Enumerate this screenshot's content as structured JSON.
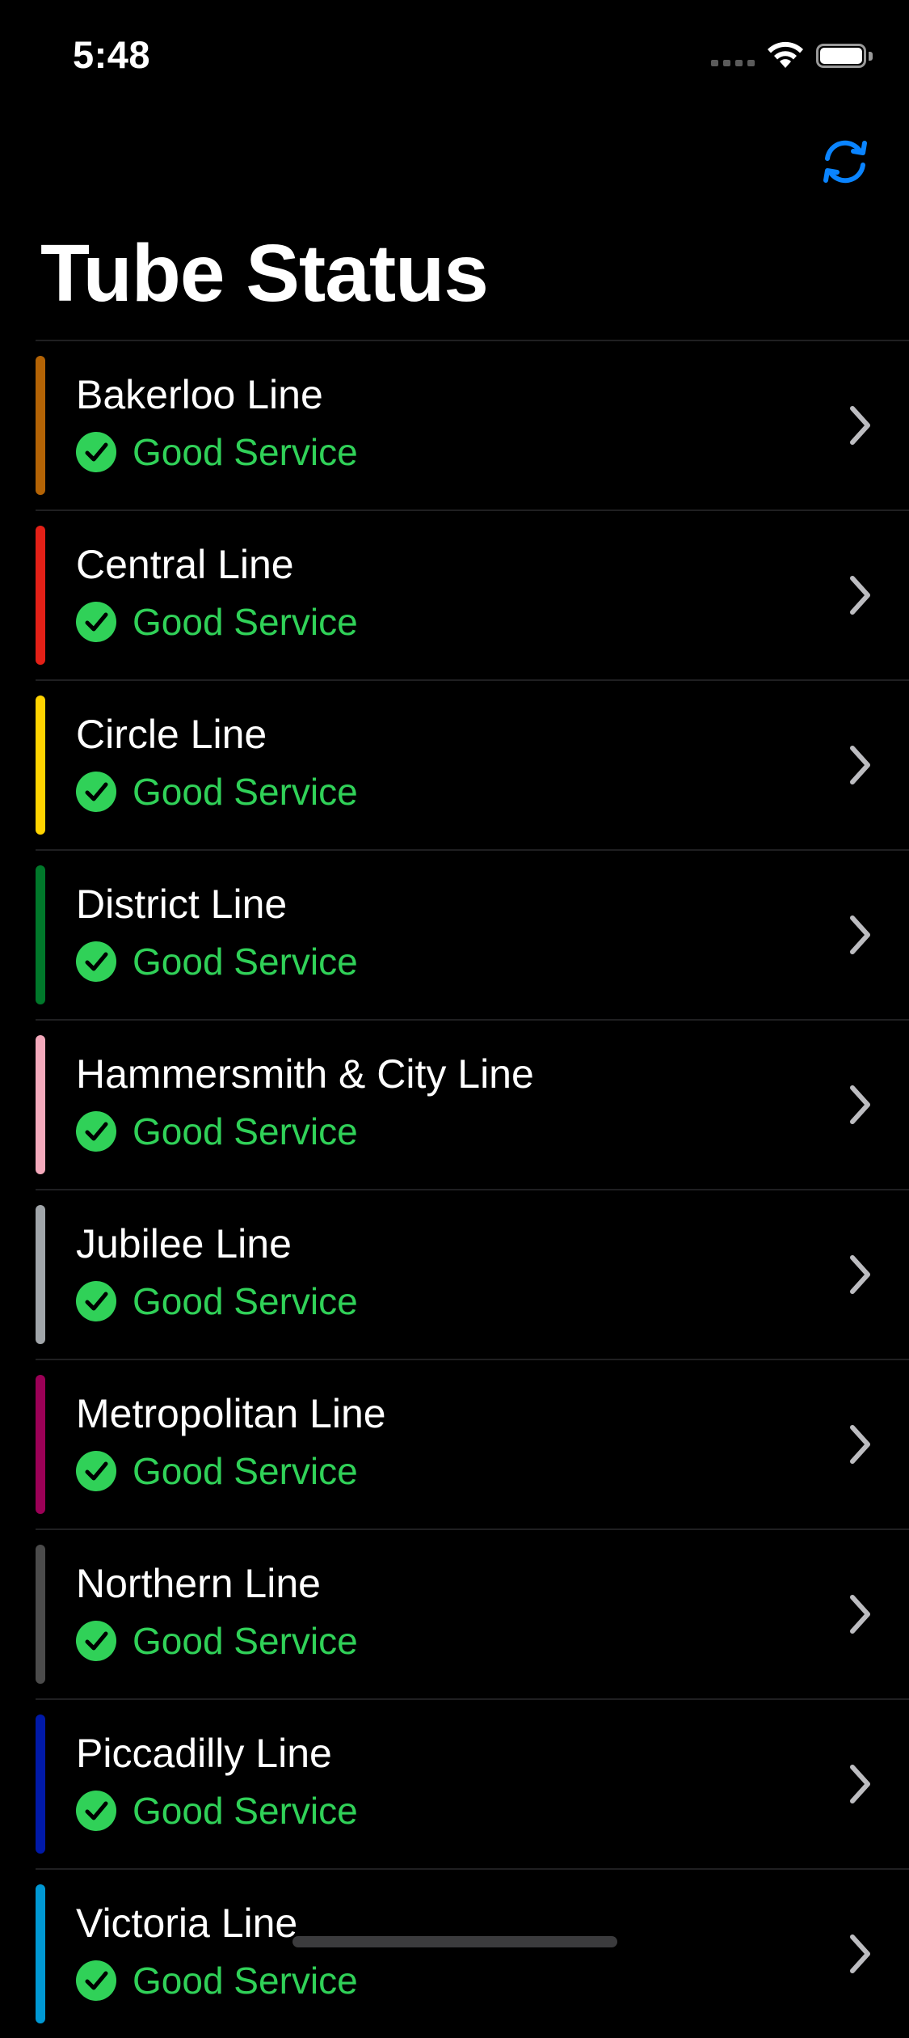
{
  "status_bar": {
    "time": "5:48"
  },
  "nav": {
    "refresh_icon": "refresh-icon",
    "title": "Tube Status"
  },
  "colors": {
    "accent": "#0a84ff",
    "good_service": "#30d158",
    "background": "#000000"
  },
  "lines": [
    {
      "name": "Bakerloo Line",
      "status": "Good Service",
      "color": "#b36305"
    },
    {
      "name": "Central Line",
      "status": "Good Service",
      "color": "#e32017"
    },
    {
      "name": "Circle Line",
      "status": "Good Service",
      "color": "#ffd300"
    },
    {
      "name": "District Line",
      "status": "Good Service",
      "color": "#00782a"
    },
    {
      "name": "Hammersmith & City Line",
      "status": "Good Service",
      "color": "#f3a9bb"
    },
    {
      "name": "Jubilee Line",
      "status": "Good Service",
      "color": "#a0a5a9"
    },
    {
      "name": "Metropolitan Line",
      "status": "Good Service",
      "color": "#9b0056"
    },
    {
      "name": "Northern Line",
      "status": "Good Service",
      "color": "#4b4b4b"
    },
    {
      "name": "Piccadilly Line",
      "status": "Good Service",
      "color": "#0019a8"
    },
    {
      "name": "Victoria Line",
      "status": "Good Service",
      "color": "#0098d4"
    }
  ]
}
